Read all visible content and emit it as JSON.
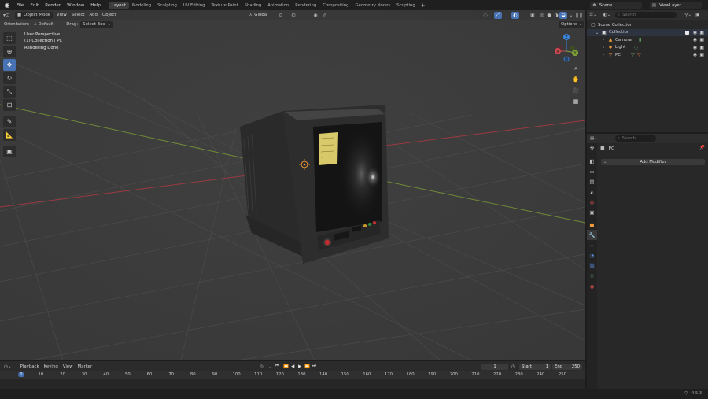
{
  "topbar": {
    "menus": [
      "File",
      "Edit",
      "Render",
      "Window",
      "Help"
    ],
    "workspaces": [
      "Layout",
      "Modeling",
      "Sculpting",
      "UV Editing",
      "Texture Paint",
      "Shading",
      "Animation",
      "Rendering",
      "Compositing",
      "Geometry Nodes",
      "Scripting"
    ],
    "active_workspace": "Layout",
    "scene_label": "Scene",
    "view_layer_label": "ViewLayer"
  },
  "viewport": {
    "mode": "Object Mode",
    "menus": [
      "View",
      "Select",
      "Add",
      "Object"
    ],
    "transform_orientation": "Global",
    "orientation_label": "Orientation:",
    "orientation_value": "Default",
    "drag_label": "Drag:",
    "drag_value": "Select Box",
    "options_label": "Options",
    "overlay_lines": [
      "User Perspective",
      "(1) Collection | PC",
      "Rendering Done"
    ],
    "gizmo": {
      "x": "X",
      "y": "Y",
      "z": "Z"
    }
  },
  "outliner": {
    "search_placeholder": "Search",
    "root": "Scene Collection",
    "collection": "Collection",
    "items": [
      {
        "label": "Camera",
        "icon": "camera-icon"
      },
      {
        "label": "Light",
        "icon": "light-icon"
      },
      {
        "label": "PC",
        "icon": "mesh-icon"
      }
    ]
  },
  "properties": {
    "search_placeholder": "Search",
    "object_name": "PC",
    "add_modifier_label": "Add Modifier"
  },
  "timeline": {
    "menus": [
      "Playback",
      "Keying",
      "View",
      "Marker"
    ],
    "current_frame": "1",
    "start_label": "Start",
    "start_value": "1",
    "end_label": "End",
    "end_value": "250",
    "ruler": [
      "1",
      "10",
      "20",
      "30",
      "40",
      "50",
      "60",
      "70",
      "80",
      "90",
      "100",
      "110",
      "120",
      "130",
      "140",
      "150",
      "160",
      "170",
      "180",
      "190",
      "200",
      "210",
      "220",
      "230",
      "240",
      "250"
    ]
  },
  "statusbar": {
    "version": "4.5.3"
  },
  "colors": {
    "accent": "#4772b3",
    "x_axis": "#c94a50",
    "y_axis": "#7fa23a",
    "z_axis": "#3d84db",
    "active_obj": "#f09a3a"
  }
}
